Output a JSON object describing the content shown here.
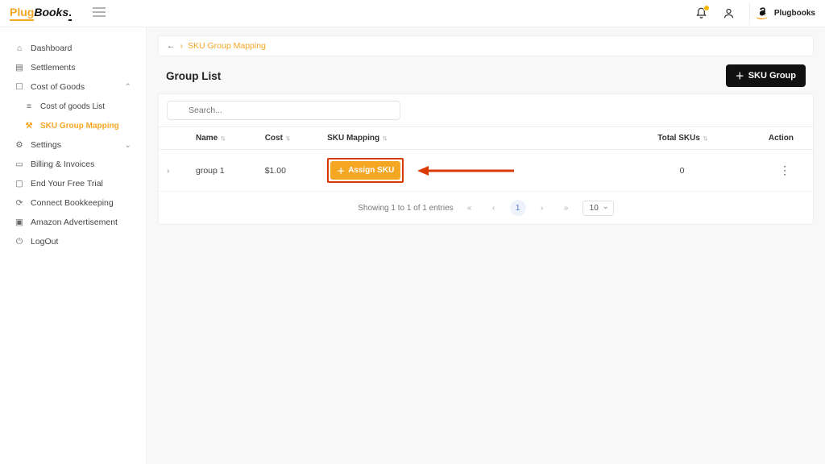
{
  "brand": {
    "p1": "Plug",
    "p2": "Books",
    "p3": "."
  },
  "header": {
    "account_label": "Plugbooks"
  },
  "sidebar": {
    "items": [
      {
        "label": "Dashboard"
      },
      {
        "label": "Settlements"
      },
      {
        "label": "Cost of Goods"
      },
      {
        "label": "Cost of goods List"
      },
      {
        "label": "SKU Group Mapping"
      },
      {
        "label": "Settings"
      },
      {
        "label": "Billing & Invoices"
      },
      {
        "label": "End Your Free Trial"
      },
      {
        "label": "Connect Bookkeeping"
      },
      {
        "label": "Amazon Advertisement"
      },
      {
        "label": "LogOut"
      }
    ]
  },
  "breadcrumb": {
    "current": "SKU Group Mapping"
  },
  "page": {
    "title": "Group List",
    "primary_btn": "SKU Group"
  },
  "search": {
    "placeholder": "Search..."
  },
  "table": {
    "headers": {
      "name": "Name",
      "cost": "Cost",
      "sku": "SKU Mapping",
      "total": "Total SKUs",
      "action": "Action"
    },
    "rows": [
      {
        "name": "group 1",
        "cost": "$1.00",
        "assign_label": "Assign SKU",
        "total": "0"
      }
    ]
  },
  "pagination": {
    "summary": "Showing 1 to 1 of 1 entries",
    "current": "1",
    "page_size": "10"
  }
}
